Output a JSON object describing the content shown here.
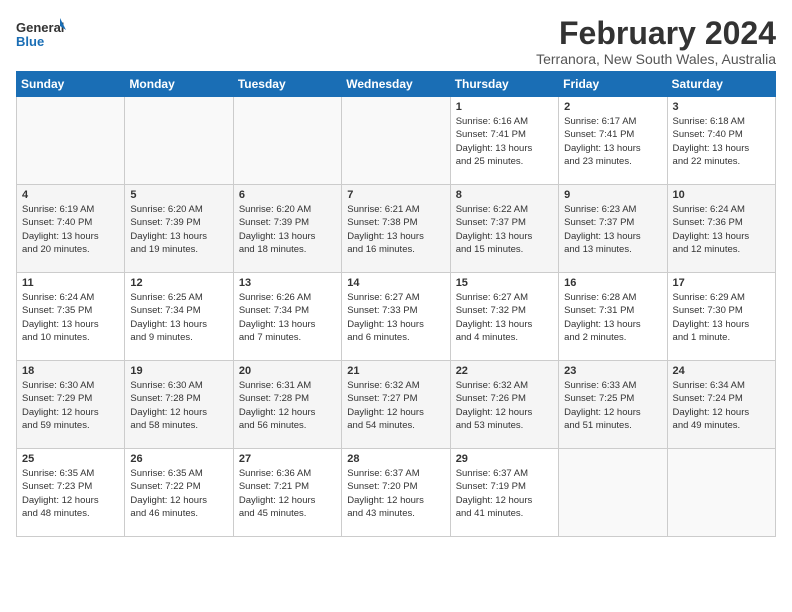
{
  "header": {
    "logo_general": "General",
    "logo_blue": "Blue",
    "month": "February 2024",
    "location": "Terranora, New South Wales, Australia"
  },
  "weekdays": [
    "Sunday",
    "Monday",
    "Tuesday",
    "Wednesday",
    "Thursday",
    "Friday",
    "Saturday"
  ],
  "weeks": [
    [
      {
        "day": "",
        "info": ""
      },
      {
        "day": "",
        "info": ""
      },
      {
        "day": "",
        "info": ""
      },
      {
        "day": "",
        "info": ""
      },
      {
        "day": "1",
        "info": "Sunrise: 6:16 AM\nSunset: 7:41 PM\nDaylight: 13 hours\nand 25 minutes."
      },
      {
        "day": "2",
        "info": "Sunrise: 6:17 AM\nSunset: 7:41 PM\nDaylight: 13 hours\nand 23 minutes."
      },
      {
        "day": "3",
        "info": "Sunrise: 6:18 AM\nSunset: 7:40 PM\nDaylight: 13 hours\nand 22 minutes."
      }
    ],
    [
      {
        "day": "4",
        "info": "Sunrise: 6:19 AM\nSunset: 7:40 PM\nDaylight: 13 hours\nand 20 minutes."
      },
      {
        "day": "5",
        "info": "Sunrise: 6:20 AM\nSunset: 7:39 PM\nDaylight: 13 hours\nand 19 minutes."
      },
      {
        "day": "6",
        "info": "Sunrise: 6:20 AM\nSunset: 7:39 PM\nDaylight: 13 hours\nand 18 minutes."
      },
      {
        "day": "7",
        "info": "Sunrise: 6:21 AM\nSunset: 7:38 PM\nDaylight: 13 hours\nand 16 minutes."
      },
      {
        "day": "8",
        "info": "Sunrise: 6:22 AM\nSunset: 7:37 PM\nDaylight: 13 hours\nand 15 minutes."
      },
      {
        "day": "9",
        "info": "Sunrise: 6:23 AM\nSunset: 7:37 PM\nDaylight: 13 hours\nand 13 minutes."
      },
      {
        "day": "10",
        "info": "Sunrise: 6:24 AM\nSunset: 7:36 PM\nDaylight: 13 hours\nand 12 minutes."
      }
    ],
    [
      {
        "day": "11",
        "info": "Sunrise: 6:24 AM\nSunset: 7:35 PM\nDaylight: 13 hours\nand 10 minutes."
      },
      {
        "day": "12",
        "info": "Sunrise: 6:25 AM\nSunset: 7:34 PM\nDaylight: 13 hours\nand 9 minutes."
      },
      {
        "day": "13",
        "info": "Sunrise: 6:26 AM\nSunset: 7:34 PM\nDaylight: 13 hours\nand 7 minutes."
      },
      {
        "day": "14",
        "info": "Sunrise: 6:27 AM\nSunset: 7:33 PM\nDaylight: 13 hours\nand 6 minutes."
      },
      {
        "day": "15",
        "info": "Sunrise: 6:27 AM\nSunset: 7:32 PM\nDaylight: 13 hours\nand 4 minutes."
      },
      {
        "day": "16",
        "info": "Sunrise: 6:28 AM\nSunset: 7:31 PM\nDaylight: 13 hours\nand 2 minutes."
      },
      {
        "day": "17",
        "info": "Sunrise: 6:29 AM\nSunset: 7:30 PM\nDaylight: 13 hours\nand 1 minute."
      }
    ],
    [
      {
        "day": "18",
        "info": "Sunrise: 6:30 AM\nSunset: 7:29 PM\nDaylight: 12 hours\nand 59 minutes."
      },
      {
        "day": "19",
        "info": "Sunrise: 6:30 AM\nSunset: 7:28 PM\nDaylight: 12 hours\nand 58 minutes."
      },
      {
        "day": "20",
        "info": "Sunrise: 6:31 AM\nSunset: 7:28 PM\nDaylight: 12 hours\nand 56 minutes."
      },
      {
        "day": "21",
        "info": "Sunrise: 6:32 AM\nSunset: 7:27 PM\nDaylight: 12 hours\nand 54 minutes."
      },
      {
        "day": "22",
        "info": "Sunrise: 6:32 AM\nSunset: 7:26 PM\nDaylight: 12 hours\nand 53 minutes."
      },
      {
        "day": "23",
        "info": "Sunrise: 6:33 AM\nSunset: 7:25 PM\nDaylight: 12 hours\nand 51 minutes."
      },
      {
        "day": "24",
        "info": "Sunrise: 6:34 AM\nSunset: 7:24 PM\nDaylight: 12 hours\nand 49 minutes."
      }
    ],
    [
      {
        "day": "25",
        "info": "Sunrise: 6:35 AM\nSunset: 7:23 PM\nDaylight: 12 hours\nand 48 minutes."
      },
      {
        "day": "26",
        "info": "Sunrise: 6:35 AM\nSunset: 7:22 PM\nDaylight: 12 hours\nand 46 minutes."
      },
      {
        "day": "27",
        "info": "Sunrise: 6:36 AM\nSunset: 7:21 PM\nDaylight: 12 hours\nand 45 minutes."
      },
      {
        "day": "28",
        "info": "Sunrise: 6:37 AM\nSunset: 7:20 PM\nDaylight: 12 hours\nand 43 minutes."
      },
      {
        "day": "29",
        "info": "Sunrise: 6:37 AM\nSunset: 7:19 PM\nDaylight: 12 hours\nand 41 minutes."
      },
      {
        "day": "",
        "info": ""
      },
      {
        "day": "",
        "info": ""
      }
    ]
  ]
}
